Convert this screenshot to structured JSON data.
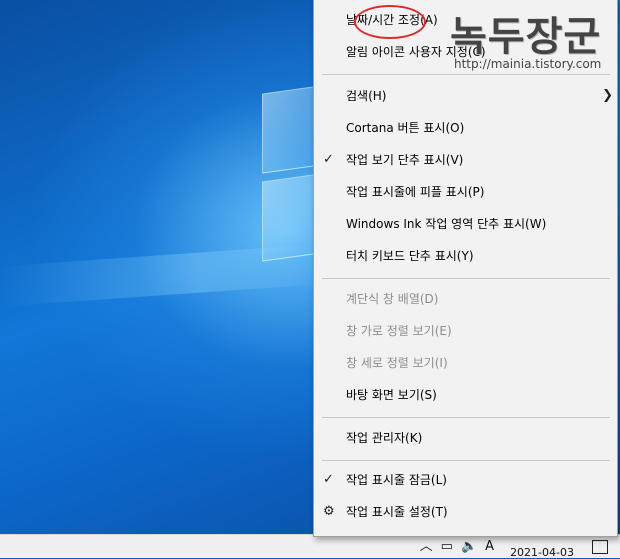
{
  "menu": {
    "items": [
      {
        "label": "날짜/시간 조정(A)",
        "checked": false,
        "disabled": false,
        "submenu": false
      },
      {
        "label": "알림 아이콘 사용자 지정(C)",
        "checked": false,
        "disabled": false,
        "submenu": false
      },
      {
        "label": "검색(H)",
        "checked": false,
        "disabled": false,
        "submenu": true
      },
      {
        "label": "Cortana 버튼 표시(O)",
        "checked": false,
        "disabled": false,
        "submenu": false
      },
      {
        "label": "작업 보기 단추 표시(V)",
        "checked": true,
        "disabled": false,
        "submenu": false
      },
      {
        "label": "작업 표시줄에 피플 표시(P)",
        "checked": false,
        "disabled": false,
        "submenu": false
      },
      {
        "label": "Windows Ink 작업 영역 단추 표시(W)",
        "checked": false,
        "disabled": false,
        "submenu": false
      },
      {
        "label": "터치 키보드 단추 표시(Y)",
        "checked": false,
        "disabled": false,
        "submenu": false
      },
      {
        "label": "계단식 창 배열(D)",
        "checked": false,
        "disabled": true,
        "submenu": false
      },
      {
        "label": "창 가로 정렬 보기(E)",
        "checked": false,
        "disabled": true,
        "submenu": false
      },
      {
        "label": "창 세로 정렬 보기(I)",
        "checked": false,
        "disabled": true,
        "submenu": false
      },
      {
        "label": "바탕 화면 보기(S)",
        "checked": false,
        "disabled": false,
        "submenu": false
      },
      {
        "label": "작업 관리자(K)",
        "checked": false,
        "disabled": false,
        "submenu": false
      },
      {
        "label": "작업 표시줄 잠금(L)",
        "checked": true,
        "disabled": false,
        "submenu": false
      },
      {
        "label": "작업 표시줄 설정(T)",
        "checked": false,
        "disabled": false,
        "submenu": false,
        "icon": "gear-icon"
      }
    ],
    "check_glyph": "✓",
    "arrow_glyph": "❯",
    "gear_glyph": "⚙"
  },
  "taskbar": {
    "input_indicator": "A",
    "date": "2021-04-03"
  },
  "watermark": {
    "title": "녹두장군",
    "url": "http://mainia.tistory.com"
  },
  "colors": {
    "menu_bg": "#f2f2f2",
    "disabled_text": "#8e8e8e",
    "highlight_circle": "#e02a2a"
  }
}
